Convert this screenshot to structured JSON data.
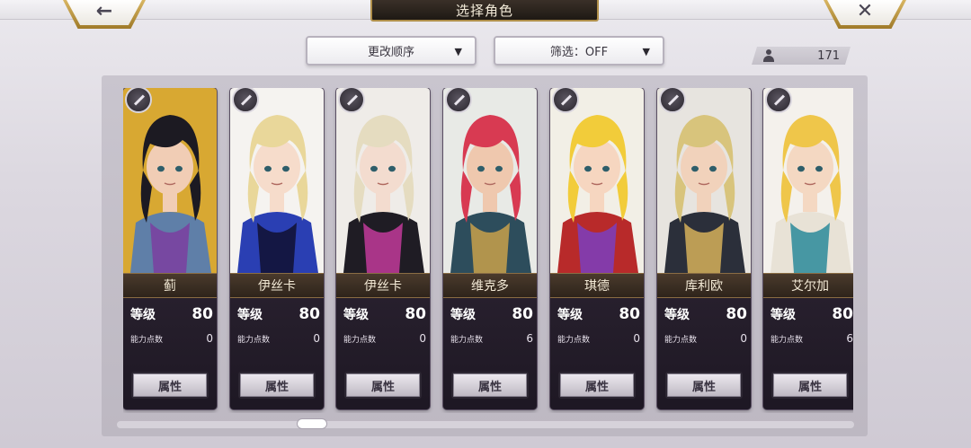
{
  "header": {
    "title": "选择角色",
    "back_icon": "←",
    "close_icon": "✕"
  },
  "toolbar": {
    "sort_label": "更改顺序",
    "filter_label": "筛选：OFF",
    "caret": "▼",
    "character_count": "171"
  },
  "colors": {
    "accent_gold": "#b08f4a",
    "card_bg": "#1e1924",
    "panel_bg": "#c4bfc9"
  },
  "cards": [
    {
      "name": "蓟",
      "level_label": "等级",
      "level": "80",
      "points_label": "能力点数",
      "points": "0",
      "button": "属性",
      "palette": {
        "hair": "#1c1a22",
        "skin": "#f1cdb5",
        "outfit": "#5f7fa8",
        "accent": "#7b3ea0",
        "bg": "#d8a832"
      }
    },
    {
      "name": "伊丝卡",
      "level_label": "等级",
      "level": "80",
      "points_label": "能力点数",
      "points": "0",
      "button": "属性",
      "palette": {
        "hair": "#e9d79a",
        "skin": "#f6dccb",
        "outfit": "#2a3fb3",
        "accent": "#101030",
        "bg": "#f5f3f0"
      }
    },
    {
      "name": "伊丝卡",
      "level_label": "等级",
      "level": "80",
      "points_label": "能力点数",
      "points": "0",
      "button": "属性",
      "palette": {
        "hair": "#e5dcc0",
        "skin": "#f3dccf",
        "outfit": "#1f1c24",
        "accent": "#c23a9a",
        "bg": "#efece8"
      }
    },
    {
      "name": "维克多",
      "level_label": "等级",
      "level": "80",
      "points_label": "能力点数",
      "points": "6",
      "button": "属性",
      "palette": {
        "hair": "#d83a52",
        "skin": "#efc8ae",
        "outfit": "#2d4d5c",
        "accent": "#c9a14a",
        "bg": "#e8eae6"
      }
    },
    {
      "name": "琪德",
      "level_label": "等级",
      "level": "80",
      "points_label": "能力点数",
      "points": "0",
      "button": "属性",
      "palette": {
        "hair": "#f2cc3a",
        "skin": "#f6d6c0",
        "outfit": "#b82a2a",
        "accent": "#7a3ec0",
        "bg": "#f2efe6"
      }
    },
    {
      "name": "库利欧",
      "level_label": "等级",
      "level": "80",
      "points_label": "能力点数",
      "points": "0",
      "button": "属性",
      "palette": {
        "hair": "#d8c47c",
        "skin": "#f1d2bb",
        "outfit": "#2b2f3a",
        "accent": "#d6b05a",
        "bg": "#e7e4df"
      }
    },
    {
      "name": "艾尔加",
      "level_label": "等级",
      "level": "80",
      "points_label": "能力点数",
      "points": "6",
      "button": "属性",
      "palette": {
        "hair": "#efc64a",
        "skin": "#f4d8c2",
        "outfit": "#e8e2d6",
        "accent": "#2a8a9a",
        "bg": "#f4f1ec"
      }
    }
  ]
}
